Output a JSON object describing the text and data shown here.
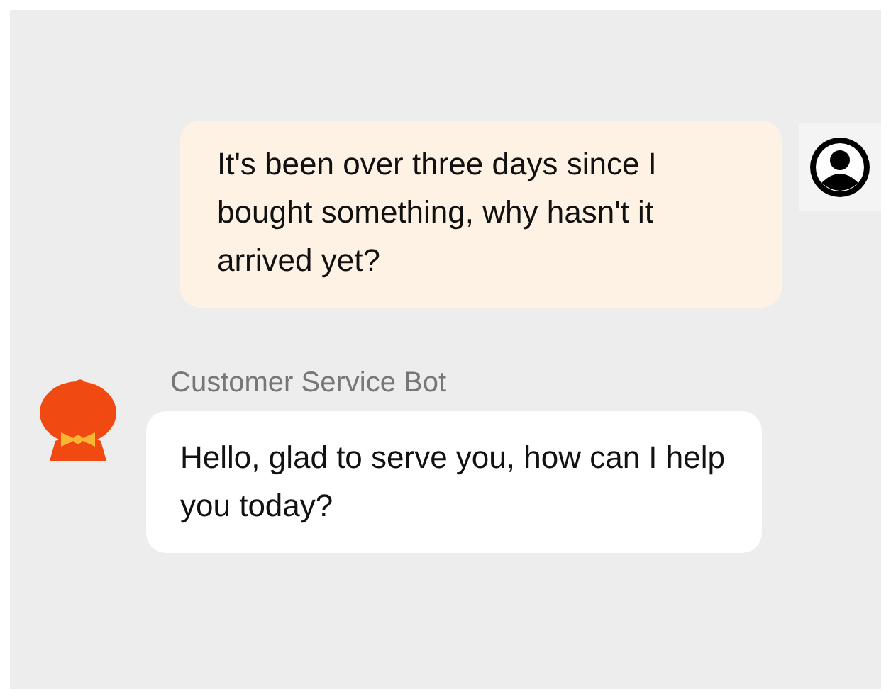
{
  "messages": [
    {
      "kind": "user",
      "text": "It's been over three days since I bought something, why hasn't it arrived yet?"
    },
    {
      "kind": "bot",
      "sender": "Customer Service Bot",
      "text": "Hello, glad to serve you, how can I help you today?"
    }
  ]
}
